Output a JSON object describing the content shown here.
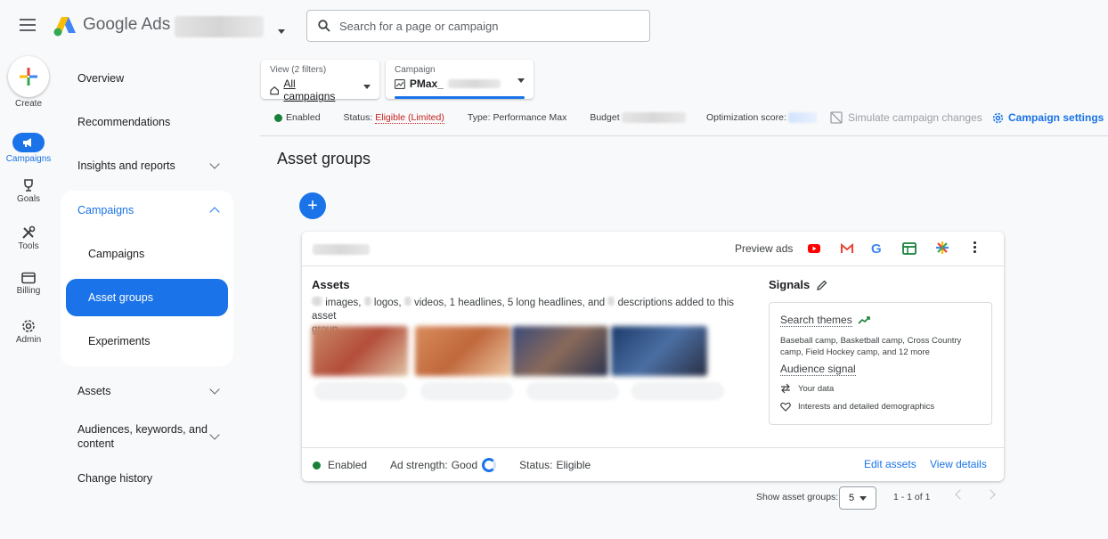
{
  "header": {
    "brand": "Google Ads",
    "search_placeholder": "Search for a page or campaign"
  },
  "rail": {
    "create": "Create",
    "campaigns": "Campaigns",
    "goals": "Goals",
    "tools": "Tools",
    "billing": "Billing",
    "admin": "Admin"
  },
  "nav": {
    "overview": "Overview",
    "recommendations": "Recommendations",
    "insights": "Insights and reports",
    "campaigns_group": "Campaigns",
    "campaigns": "Campaigns",
    "asset_groups": "Asset groups",
    "experiments": "Experiments",
    "assets": "Assets",
    "audiences_line1": "Audiences, keywords, and",
    "audiences_line2": "content",
    "change_history": "Change history"
  },
  "filters": {
    "view_label": "View (2 filters)",
    "view_value": "All campaigns",
    "campaign_label": "Campaign",
    "campaign_value": "PMax_"
  },
  "status": {
    "enabled": "Enabled",
    "status_label": "Status:",
    "status_value": "Eligible (Limited)",
    "type": "Type: Performance Max",
    "budget": "Budget",
    "optimization": "Optimization score:",
    "simulate": "Simulate campaign changes",
    "settings": "Campaign settings"
  },
  "page": {
    "title": "Asset groups"
  },
  "card": {
    "preview_ads": "Preview ads",
    "assets_title": "Assets",
    "assets_desc_1": "images,",
    "assets_desc_2": "logos,",
    "assets_desc_3": "videos, 1",
    "assets_desc_4": "headlines, 5 long headlines, and",
    "assets_desc_5": "descriptions added to this asset",
    "assets_desc_6": "group",
    "signals_title": "Signals",
    "search_themes": "Search themes",
    "themes_text": "Baseball camp, Basketball camp, Cross Country camp, Field Hockey camp, and 12 more",
    "audience_signal": "Audience signal",
    "your_data": "Your data",
    "interests": "Interests and detailed demographics",
    "foot_enabled": "Enabled",
    "ad_strength_label": "Ad strength:",
    "ad_strength_value": "Good",
    "foot_status_label": "Status:",
    "foot_status_value": "Eligible",
    "edit_assets": "Edit assets",
    "view_details": "View details"
  },
  "pager": {
    "label": "Show asset groups:",
    "size": "5",
    "range": "1 - 1 of 1"
  },
  "colors": {
    "accent": "#1a73e8",
    "enabled_green": "#188038",
    "limited_red": "#c5221f"
  }
}
